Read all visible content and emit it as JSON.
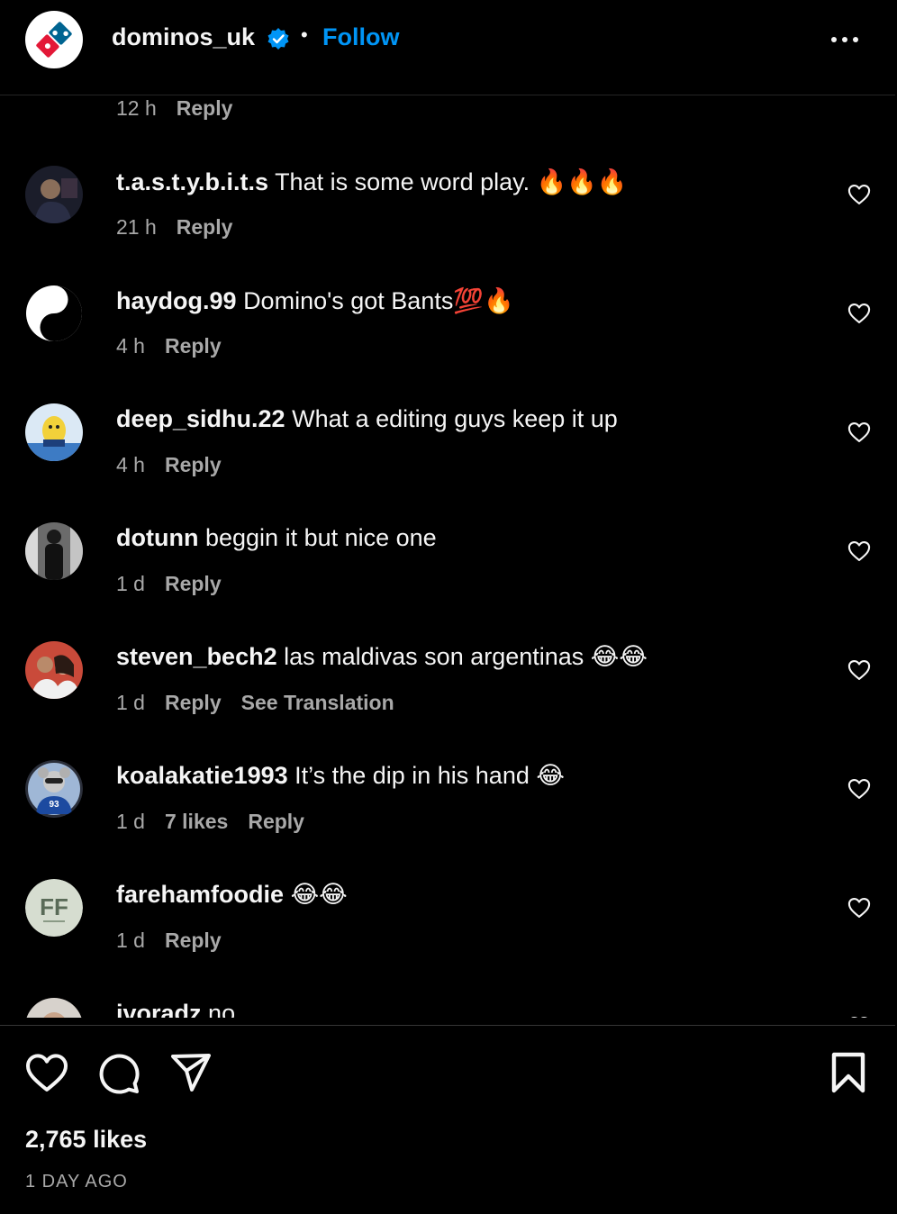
{
  "header": {
    "username": "dominos_uk",
    "separator": "•",
    "follow_label": "Follow"
  },
  "top_meta": {
    "time": "12 h",
    "reply": "Reply"
  },
  "comments": [
    {
      "username": "t.a.s.t.y.b.i.t.s",
      "text": "That is some word play. 🔥🔥🔥",
      "time": "21 h",
      "reply": "Reply"
    },
    {
      "username": "haydog.99",
      "text": "Domino's got Bants💯🔥",
      "time": "4 h",
      "reply": "Reply"
    },
    {
      "username": "deep_sidhu.22",
      "text": "What a editing guys keep it up",
      "time": "4 h",
      "reply": "Reply"
    },
    {
      "username": "dotunn",
      "text": "beggin it but nice one",
      "time": "1 d",
      "reply": "Reply"
    },
    {
      "username": "steven_bech2",
      "text": "las maldivas son argentinas 😂😂",
      "time": "1 d",
      "reply": "Reply",
      "translation": "See Translation"
    },
    {
      "username": "koalakatie1993",
      "text": "It’s the dip in his hand 😂",
      "time": "1 d",
      "likes": "7 likes",
      "reply": "Reply"
    },
    {
      "username": "farehamfoodie",
      "text": "😂😂",
      "time": "1 d",
      "reply": "Reply"
    },
    {
      "username": "ivoradz",
      "text": "no"
    }
  ],
  "avatar_text": {
    "fareham_initials": "FF",
    "koala_number": "93"
  },
  "footer": {
    "likes": "2,765 likes",
    "time_ago": "1 DAY AGO"
  },
  "colors": {
    "accent": "#0095f6",
    "background": "#000000",
    "muted": "#a8a8a8",
    "text": "#f5f5f5"
  },
  "icons": [
    "dominos-logo-icon",
    "verified-badge-icon",
    "more-options-icon",
    "heart-icon",
    "comment-icon",
    "share-icon",
    "bookmark-icon"
  ]
}
